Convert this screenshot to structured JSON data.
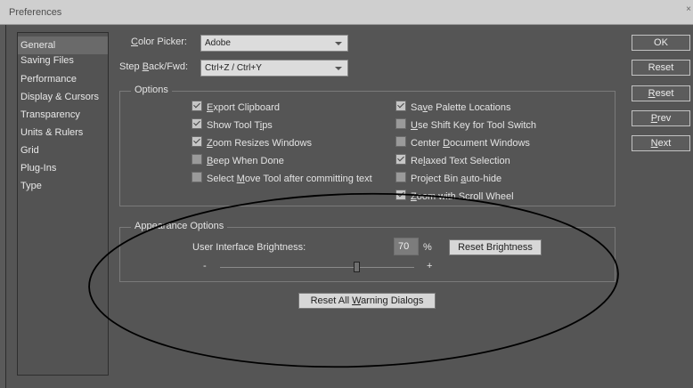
{
  "window": {
    "title": "Preferences",
    "close_glyph": "×"
  },
  "sidebar": {
    "items": [
      {
        "label": "General",
        "selected": true
      },
      {
        "label": "Saving Files"
      },
      {
        "label": "Performance"
      },
      {
        "label": "Display & Cursors"
      },
      {
        "label": "Transparency"
      },
      {
        "label": "Units & Rulers"
      },
      {
        "label": "Grid"
      },
      {
        "label": "Plug-Ins"
      },
      {
        "label": "Type"
      }
    ]
  },
  "general": {
    "color_picker": {
      "label_pre": "",
      "label_u": "C",
      "label_post": "olor Picker:",
      "value": "Adobe"
    },
    "step_back": {
      "label_pre": "Step ",
      "label_u": "B",
      "label_post": "ack/Fwd:",
      "value": "Ctrl+Z / Ctrl+Y"
    }
  },
  "options": {
    "legend": "Options",
    "left": [
      {
        "pre": "",
        "u": "E",
        "post": "xport Clipboard",
        "checked": true
      },
      {
        "pre": "Show Tool T",
        "u": "i",
        "post": "ps",
        "checked": true
      },
      {
        "pre": "",
        "u": "Z",
        "post": "oom Resizes Windows",
        "checked": true
      },
      {
        "pre": "",
        "u": "B",
        "post": "eep When Done",
        "checked": false
      },
      {
        "pre": "Select ",
        "u": "M",
        "post": "ove Tool after committing text",
        "checked": false
      }
    ],
    "right": [
      {
        "pre": "Sa",
        "u": "v",
        "post": "e Palette Locations",
        "checked": true
      },
      {
        "pre": "",
        "u": "U",
        "post": "se Shift Key for Tool Switch",
        "checked": false
      },
      {
        "pre": "Center ",
        "u": "D",
        "post": "ocument Windows",
        "checked": false
      },
      {
        "pre": "Re",
        "u": "l",
        "post": "axed Text Selection",
        "checked": true
      },
      {
        "pre": "Project Bin ",
        "u": "a",
        "post": "uto-hide",
        "checked": false
      },
      {
        "pre": "",
        "u": "Z",
        "post": "oom with Scroll Wheel",
        "checked": true
      }
    ]
  },
  "appearance": {
    "legend": "Appearance Options",
    "brightness_label": "User Interface Brightness:",
    "brightness_value": "70",
    "percent": "%",
    "reset_brightness": "Reset Brightness",
    "slider_min": "-",
    "slider_max": "+",
    "slider_level": 0.7
  },
  "reset_warnings": {
    "pre": "Reset All ",
    "u": "W",
    "post": "arning Dialogs"
  },
  "buttons": {
    "ok": "OK",
    "reset": "Reset",
    "reset2_u": "R",
    "reset2_post": "eset",
    "prev_u": "P",
    "prev_post": "rev",
    "next_u": "N",
    "next_post": "ext"
  },
  "colors": {
    "annotation": "#000000"
  }
}
